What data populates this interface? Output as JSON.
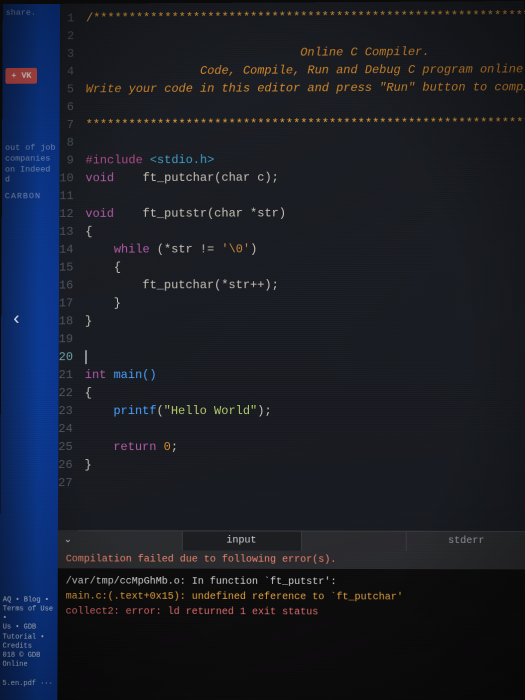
{
  "sidebar": {
    "top_share": "share.",
    "plus_btn": "+ VK",
    "mid_lines": [
      "out of job",
      "companies",
      "on Indeed",
      "d"
    ],
    "logo": "CARBON",
    "nav_arrow": "‹",
    "footer_lines": [
      "AQ • Blog • Terms of Use •",
      "Us • GDB Tutorial • Credits",
      "018 © GDB Online",
      "5.en.pdf      ···"
    ]
  },
  "header_comments": {
    "stars1": "/******************************************************************",
    "title": "                              Online C Compiler.",
    "sub1": "                Code, Compile, Run and Debug C program online.",
    "sub2": "Write your code in this editor and press \"Run\" button to compile and r",
    "blank": "",
    "stars2": "*******************************************************************"
  },
  "code": {
    "inc_pre": "#include ",
    "inc_hdr": "<stdio.h>",
    "l10_void": "void",
    "l10_sig": "    ft_putchar(char c);",
    "l12_void": "void",
    "l12_sig": "    ft_putstr(char *str)",
    "l13": "{",
    "l14_while": "while",
    "l14_cond_a": " (*str != ",
    "l14_cond_lit": "'\\0'",
    "l14_cond_b": ")",
    "l15": "    {",
    "l16": "        ft_putchar(*str++);",
    "l17": "    }",
    "l18": "}",
    "l21_int": "int",
    "l21_main": " main()",
    "l22": "{",
    "l23_printf": "printf",
    "l23_open": "(",
    "l23_str": "\"Hello World\"",
    "l23_close": ");",
    "l25_ret": "return ",
    "l25_num": "0",
    "l25_semi": ";",
    "l26": "}"
  },
  "tabs": {
    "input": "input",
    "stderr": "stderr"
  },
  "console": {
    "errbar": "Compilation failed due to following error(s).",
    "line1_a": "/var/tmp/ccMpGhMb.o: In function `",
    "line1_b": "ft_putstr",
    "line1_c": "':",
    "line2_a": "main.c:(.text+0x15): undefined reference to `",
    "line2_b": "ft_putchar",
    "line2_c": "'",
    "line3": "collect2: error: ld returned 1 exit status"
  },
  "gutter": {
    "count": 27,
    "cursor_line": 20
  }
}
